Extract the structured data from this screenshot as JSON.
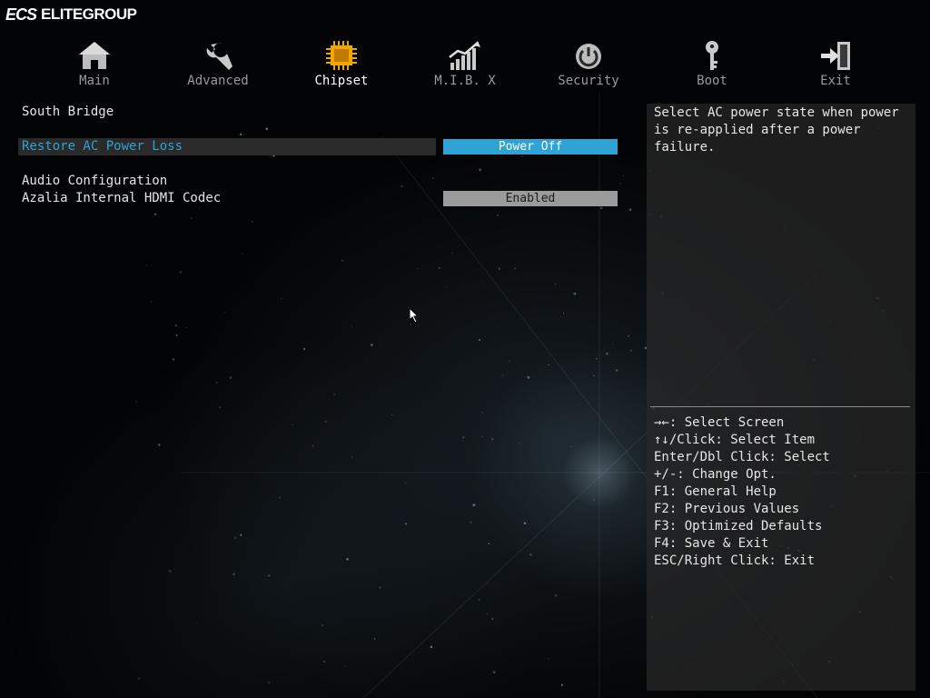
{
  "brand": {
    "mark": "ECS",
    "name": "ELITEGROUP"
  },
  "tabs": [
    {
      "label": "Main",
      "icon": "home-icon"
    },
    {
      "label": "Advanced",
      "icon": "wrench-icon"
    },
    {
      "label": "Chipset",
      "icon": "chip-icon",
      "active": true
    },
    {
      "label": "M.I.B. X",
      "icon": "chart-icon"
    },
    {
      "label": "Security",
      "icon": "power-lock-icon"
    },
    {
      "label": "Boot",
      "icon": "key-icon"
    },
    {
      "label": "Exit",
      "icon": "exit-icon"
    }
  ],
  "main": {
    "section_title": "South Bridge",
    "restore_ac": {
      "label": "Restore AC Power Loss",
      "value": "Power Off"
    },
    "audio_config": "Audio Configuration",
    "azalia": {
      "label": "Azalia Internal HDMI Codec",
      "value": "Enabled"
    }
  },
  "help": {
    "description": "Select AC power state when power is re-applied after a power failure.",
    "keys": [
      "→←: Select Screen",
      "↑↓/Click: Select Item",
      "Enter/Dbl Click: Select",
      "+/-: Change Opt.",
      "F1: General Help",
      "F2: Previous Values",
      "F3: Optimized Defaults",
      "F4: Save & Exit",
      "ESC/Right Click: Exit"
    ]
  },
  "colors": {
    "accent": "#2ea3d4",
    "chipset_icon": "#f0a800",
    "tab_inactive": "#9a9a9a",
    "panel_bg": "#282828"
  }
}
